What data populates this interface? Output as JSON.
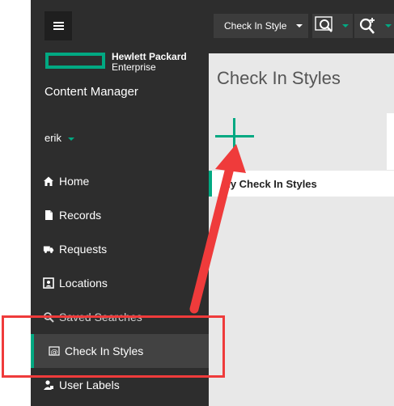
{
  "topbar": {
    "style_dropdown_label": "Check In Style"
  },
  "brand": {
    "line1": "Hewlett Packard",
    "line2": "Enterprise",
    "accent": "#01a982"
  },
  "product": {
    "name": "Content Manager"
  },
  "user": {
    "name": "erik"
  },
  "sidebar": {
    "items": [
      {
        "label": "Home",
        "icon": "home-icon"
      },
      {
        "label": "Records",
        "icon": "document-icon"
      },
      {
        "label": "Requests",
        "icon": "truck-icon"
      },
      {
        "label": "Locations",
        "icon": "contact-card-icon"
      },
      {
        "label": "Saved Searches",
        "icon": "saved-search-icon"
      },
      {
        "label": "Check In Styles",
        "icon": "at-mail-icon"
      },
      {
        "label": "User Labels",
        "icon": "user-label-icon"
      }
    ]
  },
  "main": {
    "title": "Check In Styles",
    "list_item": "My Check In Styles"
  },
  "annotation": {
    "color": "#ef3b3b"
  }
}
